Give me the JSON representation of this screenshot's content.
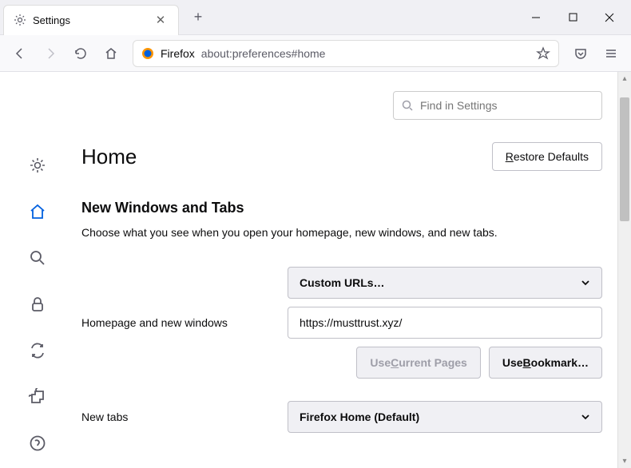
{
  "tab": {
    "title": "Settings"
  },
  "urlbar": {
    "label": "Firefox",
    "url": "about:preferences#home"
  },
  "search": {
    "placeholder": "Find in Settings"
  },
  "page": {
    "title": "Home"
  },
  "restore_button": "Restore Defaults",
  "section": {
    "title": "New Windows and Tabs",
    "desc": "Choose what you see when you open your homepage, new windows, and new tabs."
  },
  "homepage": {
    "label": "Homepage and new windows",
    "select_value": "Custom URLs…",
    "url_value": "https://musttrust.xyz/",
    "use_current": "Use Current Pages",
    "use_bookmark": "Use Bookmark…"
  },
  "newtabs": {
    "label": "New tabs",
    "select_value": "Firefox Home (Default)"
  }
}
